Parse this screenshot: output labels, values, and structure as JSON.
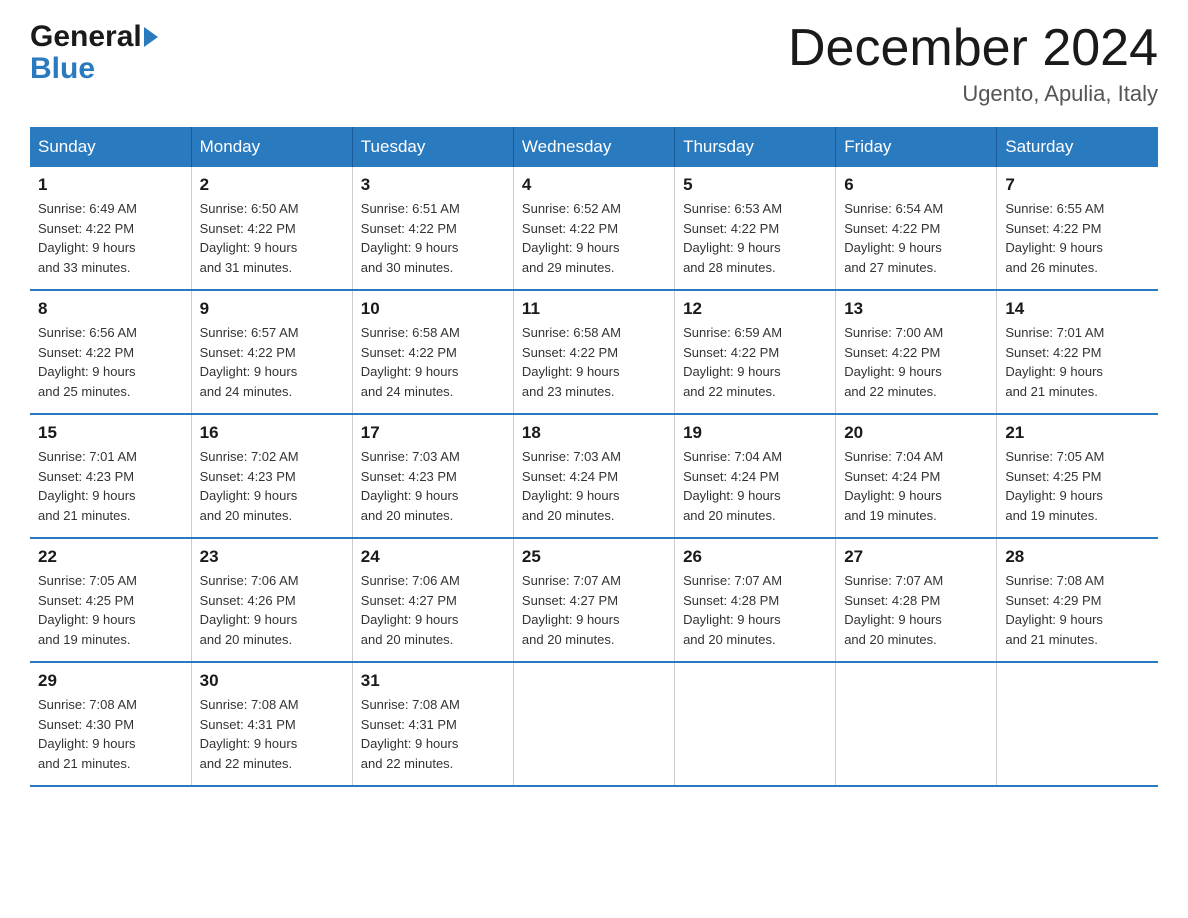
{
  "header": {
    "logo_general": "General",
    "logo_blue": "Blue",
    "month_title": "December 2024",
    "location": "Ugento, Apulia, Italy"
  },
  "days_of_week": [
    "Sunday",
    "Monday",
    "Tuesday",
    "Wednesday",
    "Thursday",
    "Friday",
    "Saturday"
  ],
  "weeks": [
    [
      {
        "day": "1",
        "sunrise": "6:49 AM",
        "sunset": "4:22 PM",
        "daylight": "9 hours and 33 minutes."
      },
      {
        "day": "2",
        "sunrise": "6:50 AM",
        "sunset": "4:22 PM",
        "daylight": "9 hours and 31 minutes."
      },
      {
        "day": "3",
        "sunrise": "6:51 AM",
        "sunset": "4:22 PM",
        "daylight": "9 hours and 30 minutes."
      },
      {
        "day": "4",
        "sunrise": "6:52 AM",
        "sunset": "4:22 PM",
        "daylight": "9 hours and 29 minutes."
      },
      {
        "day": "5",
        "sunrise": "6:53 AM",
        "sunset": "4:22 PM",
        "daylight": "9 hours and 28 minutes."
      },
      {
        "day": "6",
        "sunrise": "6:54 AM",
        "sunset": "4:22 PM",
        "daylight": "9 hours and 27 minutes."
      },
      {
        "day": "7",
        "sunrise": "6:55 AM",
        "sunset": "4:22 PM",
        "daylight": "9 hours and 26 minutes."
      }
    ],
    [
      {
        "day": "8",
        "sunrise": "6:56 AM",
        "sunset": "4:22 PM",
        "daylight": "9 hours and 25 minutes."
      },
      {
        "day": "9",
        "sunrise": "6:57 AM",
        "sunset": "4:22 PM",
        "daylight": "9 hours and 24 minutes."
      },
      {
        "day": "10",
        "sunrise": "6:58 AM",
        "sunset": "4:22 PM",
        "daylight": "9 hours and 24 minutes."
      },
      {
        "day": "11",
        "sunrise": "6:58 AM",
        "sunset": "4:22 PM",
        "daylight": "9 hours and 23 minutes."
      },
      {
        "day": "12",
        "sunrise": "6:59 AM",
        "sunset": "4:22 PM",
        "daylight": "9 hours and 22 minutes."
      },
      {
        "day": "13",
        "sunrise": "7:00 AM",
        "sunset": "4:22 PM",
        "daylight": "9 hours and 22 minutes."
      },
      {
        "day": "14",
        "sunrise": "7:01 AM",
        "sunset": "4:22 PM",
        "daylight": "9 hours and 21 minutes."
      }
    ],
    [
      {
        "day": "15",
        "sunrise": "7:01 AM",
        "sunset": "4:23 PM",
        "daylight": "9 hours and 21 minutes."
      },
      {
        "day": "16",
        "sunrise": "7:02 AM",
        "sunset": "4:23 PM",
        "daylight": "9 hours and 20 minutes."
      },
      {
        "day": "17",
        "sunrise": "7:03 AM",
        "sunset": "4:23 PM",
        "daylight": "9 hours and 20 minutes."
      },
      {
        "day": "18",
        "sunrise": "7:03 AM",
        "sunset": "4:24 PM",
        "daylight": "9 hours and 20 minutes."
      },
      {
        "day": "19",
        "sunrise": "7:04 AM",
        "sunset": "4:24 PM",
        "daylight": "9 hours and 20 minutes."
      },
      {
        "day": "20",
        "sunrise": "7:04 AM",
        "sunset": "4:24 PM",
        "daylight": "9 hours and 19 minutes."
      },
      {
        "day": "21",
        "sunrise": "7:05 AM",
        "sunset": "4:25 PM",
        "daylight": "9 hours and 19 minutes."
      }
    ],
    [
      {
        "day": "22",
        "sunrise": "7:05 AM",
        "sunset": "4:25 PM",
        "daylight": "9 hours and 19 minutes."
      },
      {
        "day": "23",
        "sunrise": "7:06 AM",
        "sunset": "4:26 PM",
        "daylight": "9 hours and 20 minutes."
      },
      {
        "day": "24",
        "sunrise": "7:06 AM",
        "sunset": "4:27 PM",
        "daylight": "9 hours and 20 minutes."
      },
      {
        "day": "25",
        "sunrise": "7:07 AM",
        "sunset": "4:27 PM",
        "daylight": "9 hours and 20 minutes."
      },
      {
        "day": "26",
        "sunrise": "7:07 AM",
        "sunset": "4:28 PM",
        "daylight": "9 hours and 20 minutes."
      },
      {
        "day": "27",
        "sunrise": "7:07 AM",
        "sunset": "4:28 PM",
        "daylight": "9 hours and 20 minutes."
      },
      {
        "day": "28",
        "sunrise": "7:08 AM",
        "sunset": "4:29 PM",
        "daylight": "9 hours and 21 minutes."
      }
    ],
    [
      {
        "day": "29",
        "sunrise": "7:08 AM",
        "sunset": "4:30 PM",
        "daylight": "9 hours and 21 minutes."
      },
      {
        "day": "30",
        "sunrise": "7:08 AM",
        "sunset": "4:31 PM",
        "daylight": "9 hours and 22 minutes."
      },
      {
        "day": "31",
        "sunrise": "7:08 AM",
        "sunset": "4:31 PM",
        "daylight": "9 hours and 22 minutes."
      },
      null,
      null,
      null,
      null
    ]
  ],
  "labels": {
    "sunrise": "Sunrise:",
    "sunset": "Sunset:",
    "daylight": "Daylight:"
  }
}
